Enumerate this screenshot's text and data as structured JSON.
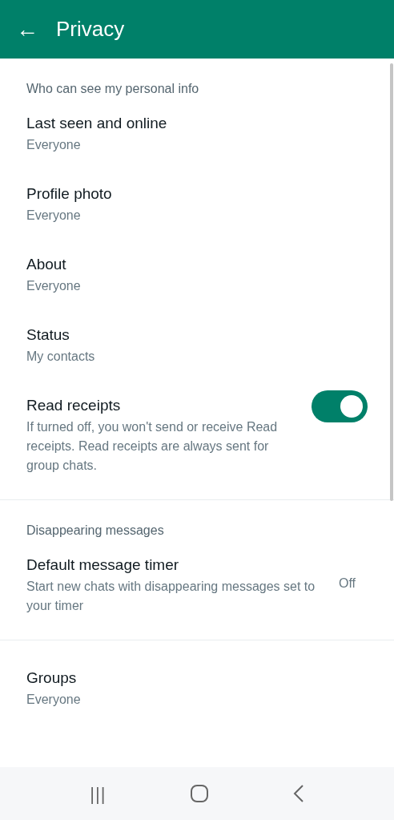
{
  "app_bar": {
    "back": "←",
    "title": "Privacy"
  },
  "sections": [
    {
      "header": "Who can see my personal info",
      "items": [
        {
          "kind": "setting",
          "title": "Last seen and online",
          "value": "Everyone"
        },
        {
          "kind": "setting",
          "title": "Profile photo",
          "value": "Everyone"
        },
        {
          "kind": "setting",
          "title": "About",
          "value": "Everyone"
        },
        {
          "kind": "setting",
          "title": "Status",
          "value": "My contacts"
        },
        {
          "kind": "toggle",
          "title": "Read receipts",
          "description": "If turned off, you won't send or receive Read receipts. Read receipts are always sent for group chats.",
          "on": true
        }
      ]
    },
    {
      "header": "Disappearing messages",
      "items": [
        {
          "kind": "value",
          "title": "Default message timer",
          "description": "Start new chats with disappearing messages set to your timer",
          "value": "Off"
        }
      ]
    },
    {
      "items": [
        {
          "kind": "setting",
          "title": "Groups",
          "value": "Everyone"
        }
      ]
    }
  ],
  "nav_bar": {
    "recents": "|||"
  }
}
